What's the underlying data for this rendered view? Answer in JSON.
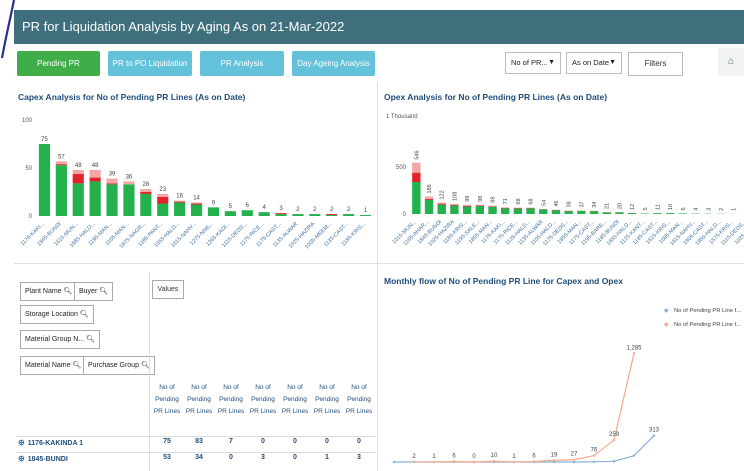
{
  "header": {
    "title": "PR for Liquidation Analysis by Aging As on 21-Mar-2022"
  },
  "nav": {
    "pending_pr": "Pending PR",
    "pr_to_po": "PR to PO Liquidation",
    "pr_analysis": "PR Analysis",
    "day_ageing": "Day Ageing Analysis"
  },
  "controls": {
    "measure_select": "No of PR...",
    "date_select": "As on Date",
    "filters": "Filters",
    "home_icon": "home-icon"
  },
  "colors": {
    "title_bar": "#3f6f7c",
    "green": "#22b14c",
    "red": "#e3232b",
    "pink": "#f2a7a7",
    "blue_line": "#8ab0d8",
    "orange_line": "#f6a98e"
  },
  "chart_data": [
    {
      "type": "bar",
      "title": "Capex Analysis for No of Pending PR Lines (As on Date)",
      "y_tick_labels": [
        "100",
        "50",
        "0"
      ],
      "ylim": [
        0,
        100
      ],
      "categories": [
        "1176-KAKI...",
        "1845-BUNDI",
        "1615-MUN...",
        "1685-HALD...",
        "1195-MAN...",
        "1165-MAN...",
        "1975-NAGR...",
        "1185-PANT...",
        "1655-HALD...",
        "1615-NAHV...",
        "1275-NNE...",
        "1265-KADI...",
        "1115-DEDS...",
        "1175-RICE...",
        "1175-CAST...",
        "1135-ALWAR",
        "1025-HAZIRA",
        "1005-MEEM...",
        "1135-CAST...",
        "1185-KRIS..."
      ],
      "totals": [
        75,
        57,
        48,
        48,
        39,
        36,
        28,
        23,
        16,
        14,
        9,
        5,
        6,
        4,
        3,
        2,
        2,
        2,
        2,
        1
      ],
      "series": [
        {
          "values": [
            75,
            53,
            34,
            36,
            33,
            33,
            23,
            13,
            14,
            12,
            9,
            5,
            6,
            4,
            2,
            2,
            2,
            1,
            2,
            1
          ]
        },
        {
          "values": [
            0,
            1,
            10,
            4,
            1,
            0,
            2,
            7,
            1,
            1,
            0,
            0,
            0,
            0,
            1,
            0,
            0,
            1,
            0,
            0
          ]
        },
        {
          "values": [
            0,
            3,
            4,
            8,
            5,
            3,
            3,
            3,
            1,
            1,
            0,
            0,
            0,
            0,
            0,
            0,
            0,
            0,
            0,
            0
          ]
        }
      ]
    },
    {
      "type": "bar",
      "title": "Opex Analysis for No of Pending PR Lines (As on Date)",
      "y_unit_label": "1 Thousand",
      "y_tick_labels": [
        "500",
        "0"
      ],
      "ylim": [
        0,
        1000
      ],
      "categories": [
        "1015-MUN...",
        "1165-AHAR...",
        "1845-BUNDI",
        "1025-HAZIRA",
        "1185-KRIS...",
        "1195-SALE...",
        "1855-MAN...",
        "1175-KAKI...",
        "1175-RICE...",
        "1125-HALD...",
        "1135-ALWAR",
        "1105-HALD...",
        "1175-DEDS...",
        "1855-MAN...",
        "1175-CAST...",
        "1195-BARE...",
        "1185-BUNDI",
        "1655-HALD...",
        "1125-KANT...",
        "1185-CAST...",
        "1615-KRIS...",
        "1685-MAN...",
        "1615-NAHV...",
        "1905-CAST...",
        "1955-HALD...",
        "1575-KRIS...",
        "1115-DEDS...",
        "1025-KOIE...",
        "1605-RICE...",
        "1305-SAHU...",
        "1605-UR-RD...",
        "1605-SAHU...",
        "1505-MAN..."
      ],
      "totals": [
        546,
        186,
        122,
        108,
        98,
        98,
        88,
        71,
        68,
        68,
        54,
        46,
        38,
        37,
        34,
        21,
        20,
        12,
        5,
        11,
        10,
        6,
        4,
        3,
        2,
        1
      ],
      "series": [
        {
          "values": [
            340,
            150,
            100,
            90,
            80,
            85,
            78,
            60,
            58,
            60,
            48,
            40,
            30,
            32,
            30,
            17,
            18,
            10,
            5,
            9,
            10,
            6,
            4,
            3,
            2,
            1
          ]
        },
        {
          "values": [
            100,
            10,
            10,
            8,
            8,
            5,
            5,
            6,
            5,
            4,
            3,
            3,
            4,
            2,
            2,
            2,
            1,
            1,
            0,
            1,
            0,
            0,
            0,
            0,
            0,
            0
          ]
        },
        {
          "values": [
            106,
            26,
            12,
            10,
            10,
            8,
            5,
            5,
            5,
            4,
            3,
            3,
            4,
            3,
            2,
            2,
            1,
            1,
            0,
            1,
            0,
            0,
            0,
            0,
            0,
            0
          ]
        }
      ]
    },
    {
      "type": "line",
      "title": "Monthly flow of No of Pending PR Line for Capex and Opex",
      "series": [
        {
          "name": "No of Pending PR Line f...",
          "values": [
            0,
            0,
            0,
            0,
            0,
            0,
            0,
            0,
            0,
            0,
            2,
            8,
            75,
            313
          ]
        },
        {
          "name": "No of Pending PR Line f...",
          "values": [
            2,
            1,
            6,
            0,
            10,
            1,
            6,
            19,
            27,
            76,
            259,
            1285
          ]
        }
      ],
      "data_labels_orange": [
        "2",
        "1",
        "6",
        "0",
        "10",
        "1",
        "6",
        "19",
        "27",
        "76",
        "259",
        "1,285"
      ],
      "data_labels_blue": [
        "313"
      ]
    }
  ],
  "pivot": {
    "fields": {
      "plant_name": "Plant Name",
      "buyer": "Buyer",
      "storage_location": "Storage Location",
      "material_group": "Material Group N...",
      "material_name": "Material Name",
      "purchase_group": "Purchase Group"
    },
    "values_label": "Values",
    "columns": [
      "No of Pending PR Lines",
      "No of Pending PR Lines",
      "No of Pending PR Lines",
      "No of Pending PR Lines",
      "No of Pending PR Lines",
      "No of Pending PR Lines",
      "No of Pending PR Lines"
    ],
    "rows": [
      {
        "label": "1176-KAKINDA 1",
        "values": [
          "75",
          "83",
          "7",
          "0",
          "0",
          "0",
          "0"
        ]
      },
      {
        "label": "1845-BUNDI",
        "values": [
          "53",
          "34",
          "0",
          "3",
          "0",
          "1",
          "3"
        ]
      }
    ]
  }
}
